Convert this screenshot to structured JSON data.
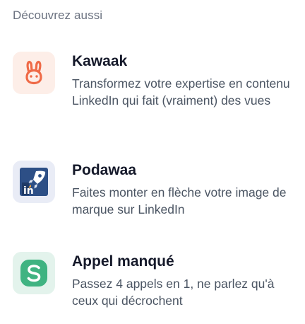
{
  "section": {
    "title": "Découvrez aussi"
  },
  "apps": [
    {
      "name": "Kawaak",
      "description": "Transformez votre expertise en contenu LinkedIn qui fait (vraiment) des vues",
      "icon": "bunny-logo-icon",
      "color": "#ef6a47"
    },
    {
      "name": "Podawaa",
      "description": "Faites monter en flèche votre image de marque sur LinkedIn",
      "icon": "rocket-linkedin-logo-icon",
      "color": "#2d4f86"
    },
    {
      "name": "Appel manqué",
      "description": "Passez 4 appels en 1, ne parlez qu'à ceux qui décrochent",
      "icon": "s-logo-icon",
      "color": "#3fb381"
    }
  ]
}
